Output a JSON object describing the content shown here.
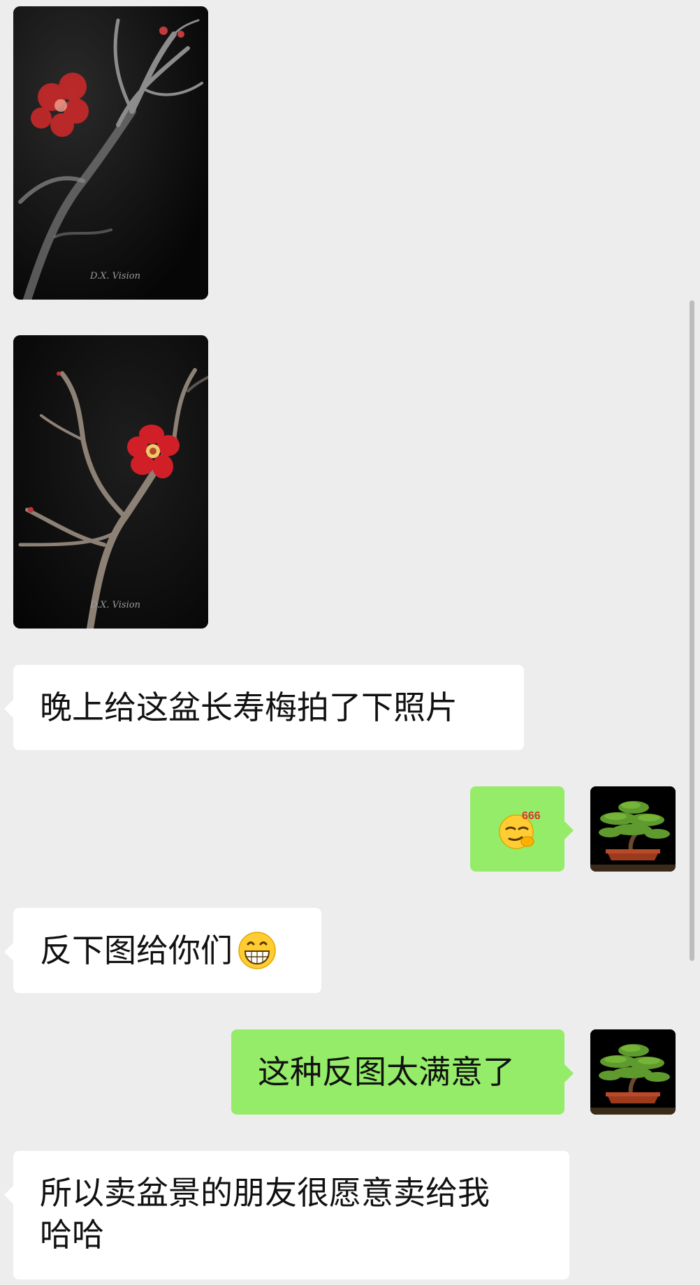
{
  "chat": {
    "messages": [
      {
        "type": "image",
        "direction": "incoming",
        "watermark": "D.X. Vision",
        "subject": "chinese-quince-branch-blossom"
      },
      {
        "type": "image",
        "direction": "incoming",
        "watermark": "D.X. Vision",
        "subject": "chinese-quince-red-flower"
      },
      {
        "type": "text",
        "direction": "incoming",
        "text": "晚上给这盆长寿梅拍了下照片"
      },
      {
        "type": "sticker",
        "direction": "outgoing",
        "sticker_text": "666",
        "icon": "smirk-666-emoji"
      },
      {
        "type": "text",
        "direction": "incoming",
        "text": "反下图给你们",
        "icon": "grin-emoji"
      },
      {
        "type": "text",
        "direction": "outgoing",
        "text": "这种反图太满意了"
      },
      {
        "type": "text",
        "direction": "incoming",
        "text": "所以卖盆景的朋友很愿意卖给我\n哈哈"
      }
    ],
    "self_avatar": "bonsai-pine-avatar"
  },
  "colors": {
    "background": "#ededed",
    "incoming_bubble": "#ffffff",
    "outgoing_bubble": "#95ec69",
    "text": "#111111"
  }
}
